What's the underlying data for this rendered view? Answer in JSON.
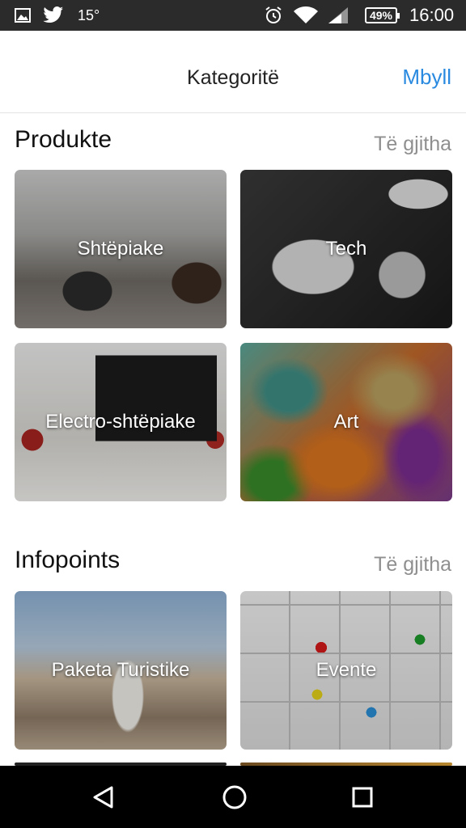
{
  "status_bar": {
    "temperature": "15°",
    "battery": "49%",
    "time": "16:00",
    "icons": [
      "image-icon",
      "twitter-icon",
      "alarm-icon",
      "wifi-icon",
      "signal-icon",
      "battery-icon"
    ]
  },
  "header": {
    "title": "Kategoritë",
    "close_label": "Mbyll"
  },
  "sections": [
    {
      "title": "Produkte",
      "see_all": "Të gjitha",
      "items": [
        {
          "label": "Shtëpiake"
        },
        {
          "label": "Tech"
        },
        {
          "label": "Electro-shtëpiake"
        },
        {
          "label": "Art"
        }
      ]
    },
    {
      "title": "Infopoints",
      "see_all": "Të gjitha",
      "items": [
        {
          "label": "Paketa Turistike"
        },
        {
          "label": "Evente"
        }
      ]
    }
  ],
  "nav_bar": {
    "icons": [
      "back-icon",
      "home-icon",
      "recents-icon"
    ]
  },
  "colors": {
    "accent": "#2a8ae0",
    "status_bar_bg": "#2b2b2b",
    "nav_bar_bg": "#000000",
    "see_all_text": "#8f8f8f"
  }
}
